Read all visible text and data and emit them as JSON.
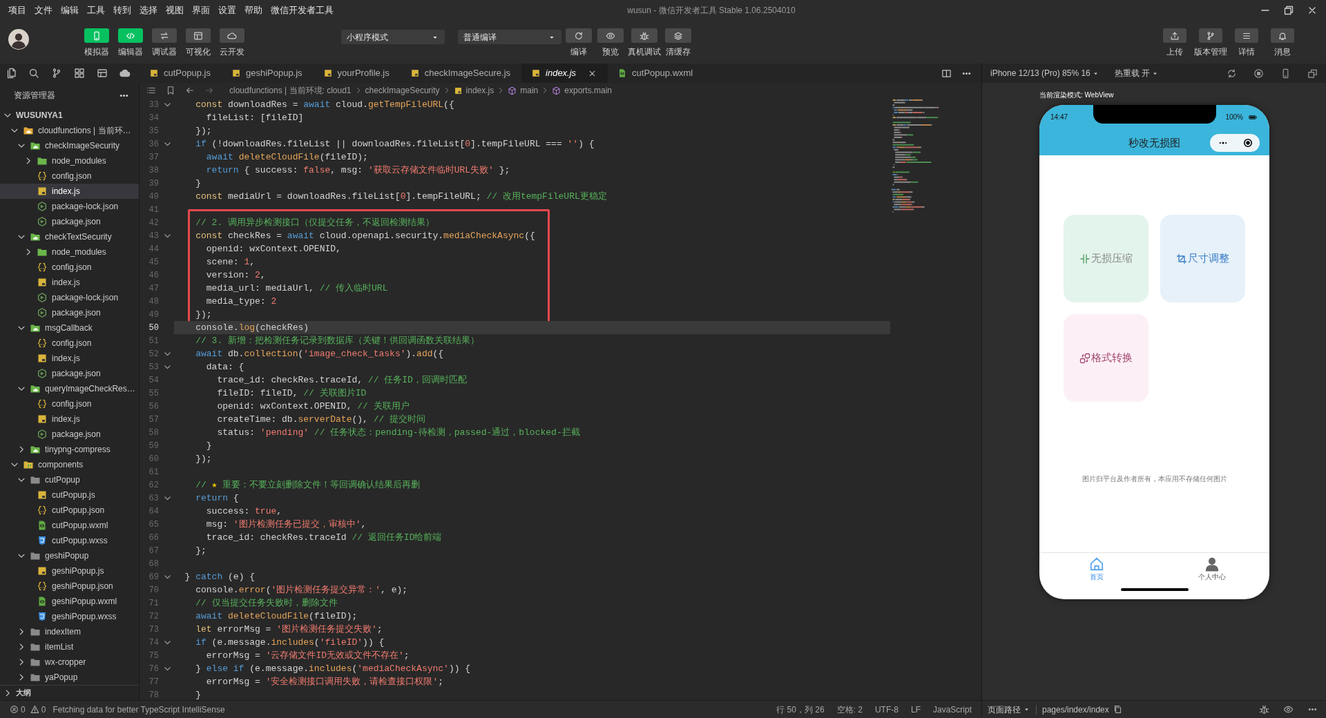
{
  "window": {
    "title": "wusun - 微信开发者工具 Stable 1.06.2504010"
  },
  "menu": [
    "项目",
    "文件",
    "编辑",
    "工具",
    "转到",
    "选择",
    "视图",
    "界面",
    "设置",
    "帮助",
    "微信开发者工具"
  ],
  "mode_buttons": [
    {
      "label": "模拟器",
      "selected": true
    },
    {
      "label": "编辑器",
      "selected": true
    },
    {
      "label": "调试器",
      "selected": false
    },
    {
      "label": "可视化",
      "selected": false
    },
    {
      "label": "云开发",
      "selected": false
    }
  ],
  "dropdowns": [
    {
      "value": "小程序模式"
    },
    {
      "value": "普通编译"
    }
  ],
  "compile_buttons": [
    {
      "label": "编译"
    },
    {
      "label": "预览"
    },
    {
      "label": "真机调试"
    },
    {
      "label": "清缓存"
    }
  ],
  "right_buttons": [
    {
      "label": "上传"
    },
    {
      "label": "版本管理"
    },
    {
      "label": "详情"
    },
    {
      "label": "消息"
    }
  ],
  "tabs": [
    {
      "label": "cutPopup.js",
      "kind": "js",
      "selected": false
    },
    {
      "label": "geshiPopup.js",
      "kind": "js",
      "selected": false
    },
    {
      "label": "yourProfile.js",
      "kind": "js",
      "selected": false
    },
    {
      "label": "checkImageSecure.js",
      "kind": "js",
      "selected": false
    },
    {
      "label": "index.js",
      "kind": "js",
      "selected": true
    },
    {
      "label": "cutPopup.wxml",
      "kind": "wxml",
      "selected": false
    }
  ],
  "breadcrumb": [
    {
      "label": "cloudfunctions | 当前环境: cloud1",
      "kind": "path"
    },
    {
      "label": "checkImageSecurity",
      "kind": "path"
    },
    {
      "label": "index.js",
      "kind": "file"
    },
    {
      "label": "main",
      "kind": "symbol"
    },
    {
      "label": "exports.main",
      "kind": "symbol"
    }
  ],
  "explorer": {
    "title": "资源管理器",
    "root": {
      "label": "WUSUNYA1",
      "kind": "workspace",
      "expanded": true,
      "selected": false,
      "children": [
        {
          "label": "cloudfunctions | 当前环…",
          "kind": "cloudroot",
          "expanded": true,
          "selected": false,
          "children": [
            {
              "label": "checkImageSecurity",
              "kind": "cloudfn",
              "expanded": true,
              "selected": false,
              "children": [
                {
                  "label": "node_modules",
                  "kind": "nodefolder",
                  "expanded": false,
                  "selected": false
                },
                {
                  "label": "config.json",
                  "kind": "json",
                  "selected": false
                },
                {
                  "label": "index.js",
                  "kind": "js",
                  "selected": true
                },
                {
                  "label": "package-lock.json",
                  "kind": "npm",
                  "selected": false
                },
                {
                  "label": "package.json",
                  "kind": "npm",
                  "selected": false
                }
              ]
            },
            {
              "label": "checkTextSecurity",
              "kind": "cloudfn",
              "expanded": true,
              "selected": false,
              "children": [
                {
                  "label": "node_modules",
                  "kind": "nodefolder",
                  "expanded": false,
                  "selected": false
                },
                {
                  "label": "config.json",
                  "kind": "json",
                  "selected": false
                },
                {
                  "label": "index.js",
                  "kind": "js",
                  "selected": false
                },
                {
                  "label": "package-lock.json",
                  "kind": "npm",
                  "selected": false
                },
                {
                  "label": "package.json",
                  "kind": "npm",
                  "selected": false
                }
              ]
            },
            {
              "label": "msgCallback",
              "kind": "cloudfn",
              "expanded": true,
              "selected": false,
              "children": [
                {
                  "label": "config.json",
                  "kind": "json",
                  "selected": false
                },
                {
                  "label": "index.js",
                  "kind": "js",
                  "selected": false
                },
                {
                  "label": "package.json",
                  "kind": "npm",
                  "selected": false
                }
              ]
            },
            {
              "label": "queryImageCheckRes…",
              "kind": "cloudfn",
              "expanded": true,
              "selected": false,
              "children": [
                {
                  "label": "config.json",
                  "kind": "json",
                  "selected": false
                },
                {
                  "label": "index.js",
                  "kind": "js",
                  "selected": false
                },
                {
                  "label": "package.json",
                  "kind": "npm",
                  "selected": false
                }
              ]
            },
            {
              "label": "tinypng-compress",
              "kind": "cloudfn",
              "expanded": false,
              "selected": false
            }
          ]
        },
        {
          "label": "components",
          "kind": "components",
          "expanded": true,
          "selected": false,
          "children": [
            {
              "label": "cutPopup",
              "kind": "folder",
              "expanded": true,
              "selected": false,
              "children": [
                {
                  "label": "cutPopup.js",
                  "kind": "js",
                  "selected": false
                },
                {
                  "label": "cutPopup.json",
                  "kind": "json",
                  "selected": false
                },
                {
                  "label": "cutPopup.wxml",
                  "kind": "wxml",
                  "selected": false
                },
                {
                  "label": "cutPopup.wxss",
                  "kind": "wxss",
                  "selected": false
                }
              ]
            },
            {
              "label": "geshiPopup",
              "kind": "folder",
              "expanded": true,
              "selected": false,
              "children": [
                {
                  "label": "geshiPopup.js",
                  "kind": "js",
                  "selected": false
                },
                {
                  "label": "geshiPopup.json",
                  "kind": "json",
                  "selected": false
                },
                {
                  "label": "geshiPopup.wxml",
                  "kind": "wxml",
                  "selected": false
                },
                {
                  "label": "geshiPopup.wxss",
                  "kind": "wxss",
                  "selected": false
                }
              ]
            },
            {
              "label": "indexItem",
              "kind": "folder",
              "expanded": false,
              "selected": false
            },
            {
              "label": "itemList",
              "kind": "folder",
              "expanded": false,
              "selected": false
            },
            {
              "label": "wx-cropper",
              "kind": "folder",
              "expanded": false,
              "selected": false
            },
            {
              "label": "yaPopup",
              "kind": "folder",
              "expanded": false,
              "selected": false
            }
          ]
        }
      ]
    },
    "outline": {
      "label": "大纲",
      "expanded": false
    }
  },
  "editor": {
    "segments": [
      {
        "boxed": false,
        "lines": [
          {
            "n": "33",
            "fold": true,
            "current": false,
            "tokens": [
              {
                "kind": "decl",
                "text": "    const"
              },
              {
                "kind": "plain",
                "text": " downloadRes = "
              },
              {
                "kind": "keyword",
                "text": "await"
              },
              {
                "kind": "plain",
                "text": " cloud."
              },
              {
                "kind": "function",
                "text": "getTempFileURL"
              },
              {
                "kind": "plain",
                "text": "({"
              }
            ]
          },
          {
            "n": "34",
            "fold": false,
            "current": false,
            "tokens": [
              {
                "kind": "plain",
                "text": "      fileList: [fileID]"
              }
            ]
          },
          {
            "n": "35",
            "fold": false,
            "current": false,
            "tokens": [
              {
                "kind": "plain",
                "text": "    });"
              }
            ]
          },
          {
            "n": "36",
            "fold": true,
            "current": false,
            "tokens": [
              {
                "kind": "keyword",
                "text": "    if"
              },
              {
                "kind": "plain",
                "text": " (!downloadRes.fileList || downloadRes.fileList["
              },
              {
                "kind": "number",
                "text": "0"
              },
              {
                "kind": "plain",
                "text": "].tempFileURL === "
              },
              {
                "kind": "string",
                "text": "''"
              },
              {
                "kind": "plain",
                "text": ") {"
              }
            ]
          },
          {
            "n": "37",
            "fold": false,
            "current": false,
            "tokens": [
              {
                "kind": "keyword",
                "text": "      await"
              },
              {
                "kind": "function",
                "text": " deleteCloudFile"
              },
              {
                "kind": "plain",
                "text": "(fileID);"
              }
            ]
          },
          {
            "n": "38",
            "fold": false,
            "current": false,
            "tokens": [
              {
                "kind": "keyword",
                "text": "      return"
              },
              {
                "kind": "plain",
                "text": " { success: "
              },
              {
                "kind": "number",
                "text": "false"
              },
              {
                "kind": "plain",
                "text": ", msg: "
              },
              {
                "kind": "string",
                "text": "'获取云存储文件临时URL失败'"
              },
              {
                "kind": "plain",
                "text": " };"
              }
            ]
          },
          {
            "n": "39",
            "fold": false,
            "current": false,
            "tokens": [
              {
                "kind": "plain",
                "text": "    }"
              }
            ]
          },
          {
            "n": "40",
            "fold": false,
            "current": false,
            "tokens": [
              {
                "kind": "decl",
                "text": "    const"
              },
              {
                "kind": "plain",
                "text": " mediaUrl = downloadRes.fileList["
              },
              {
                "kind": "number",
                "text": "0"
              },
              {
                "kind": "plain",
                "text": "].tempFileURL; "
              },
              {
                "kind": "comment",
                "text": "// 改用tempFileURL更稳定"
              }
            ]
          },
          {
            "n": "41",
            "fold": false,
            "current": false
          }
        ]
      },
      {
        "boxed": true,
        "lines": [
          {
            "n": "42",
            "fold": false,
            "current": false,
            "tokens": [
              {
                "kind": "comment",
                "text": "    // 2. 调用异步检测接口（仅提交任务，不返回检测结果）"
              }
            ]
          },
          {
            "n": "43",
            "fold": true,
            "current": false,
            "tokens": [
              {
                "kind": "decl",
                "text": "    const"
              },
              {
                "kind": "plain",
                "text": " checkRes = "
              },
              {
                "kind": "keyword",
                "text": "await"
              },
              {
                "kind": "plain",
                "text": " cloud.openapi.security."
              },
              {
                "kind": "function",
                "text": "mediaCheckAsync"
              },
              {
                "kind": "plain",
                "text": "({"
              }
            ]
          },
          {
            "n": "44",
            "fold": false,
            "current": false,
            "tokens": [
              {
                "kind": "plain",
                "text": "      openid: wxContext.OPENID,"
              }
            ]
          },
          {
            "n": "45",
            "fold": false,
            "current": false,
            "tokens": [
              {
                "kind": "plain",
                "text": "      scene: "
              },
              {
                "kind": "number",
                "text": "1"
              },
              {
                "kind": "plain",
                "text": ","
              }
            ]
          },
          {
            "n": "46",
            "fold": false,
            "current": false,
            "tokens": [
              {
                "kind": "plain",
                "text": "      version: "
              },
              {
                "kind": "number",
                "text": "2"
              },
              {
                "kind": "plain",
                "text": ","
              }
            ]
          },
          {
            "n": "47",
            "fold": false,
            "current": false,
            "tokens": [
              {
                "kind": "plain",
                "text": "      media_url: mediaUrl, "
              },
              {
                "kind": "comment",
                "text": "// 传入临时URL"
              }
            ]
          },
          {
            "n": "48",
            "fold": false,
            "current": false,
            "tokens": [
              {
                "kind": "plain",
                "text": "      media_type: "
              },
              {
                "kind": "number",
                "text": "2"
              }
            ]
          },
          {
            "n": "49",
            "fold": false,
            "current": false,
            "tokens": [
              {
                "kind": "plain",
                "text": "    });"
              }
            ]
          }
        ]
      },
      {
        "boxed": false,
        "lines": [
          {
            "n": "50",
            "fold": false,
            "current": true,
            "tokens": [
              {
                "kind": "plain",
                "text": "    console."
              },
              {
                "kind": "function",
                "text": "log"
              },
              {
                "kind": "plain",
                "text": "(checkRes)"
              }
            ]
          },
          {
            "n": "51",
            "fold": false,
            "current": false,
            "tokens": [
              {
                "kind": "comment",
                "text": "    // 3. 新增：把检测任务记录到数据库（关键！供回调函数关联结果）"
              }
            ]
          },
          {
            "n": "52",
            "fold": true,
            "current": false,
            "tokens": [
              {
                "kind": "keyword",
                "text": "    await"
              },
              {
                "kind": "plain",
                "text": " db."
              },
              {
                "kind": "function",
                "text": "collection"
              },
              {
                "kind": "plain",
                "text": "("
              },
              {
                "kind": "string",
                "text": "'image_check_tasks'"
              },
              {
                "kind": "plain",
                "text": ")."
              },
              {
                "kind": "function",
                "text": "add"
              },
              {
                "kind": "plain",
                "text": "({"
              }
            ]
          },
          {
            "n": "53",
            "fold": true,
            "current": false,
            "tokens": [
              {
                "kind": "plain",
                "text": "      data: {"
              }
            ]
          },
          {
            "n": "54",
            "fold": false,
            "current": false,
            "tokens": [
              {
                "kind": "plain",
                "text": "        trace_id: checkRes.traceId, "
              },
              {
                "kind": "comment",
                "text": "// 任务ID，回调时匹配"
              }
            ]
          },
          {
            "n": "55",
            "fold": false,
            "current": false,
            "tokens": [
              {
                "kind": "plain",
                "text": "        fileID: fileID, "
              },
              {
                "kind": "comment",
                "text": "// 关联图片ID"
              }
            ]
          },
          {
            "n": "56",
            "fold": false,
            "current": false,
            "tokens": [
              {
                "kind": "plain",
                "text": "        openid: wxContext.OPENID, "
              },
              {
                "kind": "comment",
                "text": "// 关联用户"
              }
            ]
          },
          {
            "n": "57",
            "fold": false,
            "current": false,
            "tokens": [
              {
                "kind": "plain",
                "text": "        createTime: db."
              },
              {
                "kind": "function",
                "text": "serverDate"
              },
              {
                "kind": "plain",
                "text": "(), "
              },
              {
                "kind": "comment",
                "text": "// 提交时间"
              }
            ]
          },
          {
            "n": "58",
            "fold": false,
            "current": false,
            "tokens": [
              {
                "kind": "plain",
                "text": "        status: "
              },
              {
                "kind": "string",
                "text": "'pending'"
              },
              {
                "kind": "comment",
                "text": " // 任务状态：pending-待检测，passed-通过，blocked-拦截"
              }
            ]
          },
          {
            "n": "59",
            "fold": false,
            "current": false,
            "tokens": [
              {
                "kind": "plain",
                "text": "      }"
              }
            ]
          },
          {
            "n": "60",
            "fold": false,
            "current": false,
            "tokens": [
              {
                "kind": "plain",
                "text": "    });"
              }
            ]
          },
          {
            "n": "61",
            "fold": false,
            "current": false
          },
          {
            "n": "62",
            "fold": false,
            "current": false,
            "tokens": [
              {
                "kind": "comment",
                "text": "    // "
              },
              {
                "kind": "emoji",
                "text": "★"
              },
              {
                "kind": "comment",
                "text": " 重要：不要立刻删除文件！等回调确认结果后再删"
              }
            ]
          },
          {
            "n": "63",
            "fold": true,
            "current": false,
            "tokens": [
              {
                "kind": "keyword",
                "text": "    return"
              },
              {
                "kind": "plain",
                "text": " {"
              }
            ]
          },
          {
            "n": "64",
            "fold": false,
            "current": false,
            "tokens": [
              {
                "kind": "plain",
                "text": "      success: "
              },
              {
                "kind": "number",
                "text": "true"
              },
              {
                "kind": "plain",
                "text": ","
              }
            ]
          },
          {
            "n": "65",
            "fold": false,
            "current": false,
            "tokens": [
              {
                "kind": "plain",
                "text": "      msg: "
              },
              {
                "kind": "string",
                "text": "'图片检测任务已提交，审核中'"
              },
              {
                "kind": "plain",
                "text": ","
              }
            ]
          },
          {
            "n": "66",
            "fold": false,
            "current": false,
            "tokens": [
              {
                "kind": "plain",
                "text": "      trace_id: checkRes.traceId "
              },
              {
                "kind": "comment",
                "text": "// 返回任务ID给前端"
              }
            ]
          },
          {
            "n": "67",
            "fold": false,
            "current": false,
            "tokens": [
              {
                "kind": "plain",
                "text": "    };"
              }
            ]
          },
          {
            "n": "68",
            "fold": false,
            "current": false
          },
          {
            "n": "69",
            "fold": true,
            "current": false,
            "tokens": [
              {
                "kind": "plain",
                "text": "  } "
              },
              {
                "kind": "keyword",
                "text": "catch"
              },
              {
                "kind": "plain",
                "text": " (e) {"
              }
            ]
          },
          {
            "n": "70",
            "fold": false,
            "current": false,
            "tokens": [
              {
                "kind": "plain",
                "text": "    console."
              },
              {
                "kind": "function",
                "text": "error"
              },
              {
                "kind": "plain",
                "text": "("
              },
              {
                "kind": "string",
                "text": "'图片检测任务提交异常：'"
              },
              {
                "kind": "plain",
                "text": ", e);"
              }
            ]
          },
          {
            "n": "71",
            "fold": false,
            "current": false,
            "tokens": [
              {
                "kind": "comment",
                "text": "    // 仅当提交任务失败时，删除文件"
              }
            ]
          },
          {
            "n": "72",
            "fold": false,
            "current": false,
            "tokens": [
              {
                "kind": "keyword",
                "text": "    await"
              },
              {
                "kind": "function",
                "text": " deleteCloudFile"
              },
              {
                "kind": "plain",
                "text": "(fileID);"
              }
            ]
          },
          {
            "n": "73",
            "fold": false,
            "current": false,
            "tokens": [
              {
                "kind": "decl",
                "text": "    let"
              },
              {
                "kind": "plain",
                "text": " errorMsg = "
              },
              {
                "kind": "string",
                "text": "'图片检测任务提交失败'"
              },
              {
                "kind": "plain",
                "text": ";"
              }
            ]
          },
          {
            "n": "74",
            "fold": true,
            "current": false,
            "tokens": [
              {
                "kind": "keyword",
                "text": "    if"
              },
              {
                "kind": "plain",
                "text": " (e.message."
              },
              {
                "kind": "function",
                "text": "includes"
              },
              {
                "kind": "plain",
                "text": "("
              },
              {
                "kind": "string",
                "text": "'fileID'"
              },
              {
                "kind": "plain",
                "text": ")) {"
              }
            ]
          },
          {
            "n": "75",
            "fold": false,
            "current": false,
            "tokens": [
              {
                "kind": "plain",
                "text": "      errorMsg = "
              },
              {
                "kind": "string",
                "text": "'云存储文件ID无效或文件不存在'"
              },
              {
                "kind": "plain",
                "text": ";"
              }
            ]
          },
          {
            "n": "76",
            "fold": true,
            "current": false,
            "tokens": [
              {
                "kind": "plain",
                "text": "    } "
              },
              {
                "kind": "keyword",
                "text": "else if"
              },
              {
                "kind": "plain",
                "text": " (e.message."
              },
              {
                "kind": "function",
                "text": "includes"
              },
              {
                "kind": "plain",
                "text": "("
              },
              {
                "kind": "string",
                "text": "'mediaCheckAsync'"
              },
              {
                "kind": "plain",
                "text": ")) {"
              }
            ]
          },
          {
            "n": "77",
            "fold": false,
            "current": false,
            "tokens": [
              {
                "kind": "plain",
                "text": "      errorMsg = "
              },
              {
                "kind": "string",
                "text": "'安全检测接口调用失败，请检查接口权限'"
              },
              {
                "kind": "plain",
                "text": ";"
              }
            ]
          },
          {
            "n": "78",
            "fold": false,
            "current": false,
            "tokens": [
              {
                "kind": "plain",
                "text": "    }"
              }
            ]
          }
        ]
      }
    ]
  },
  "simulator": {
    "device": "iPhone 12/13 (Pro) 85% 16",
    "hot_reload": "热重载 开",
    "render_mode": "当前渲染模式: WebView",
    "time": "14:47",
    "battery": "100%",
    "nav_title": "秒改无损图",
    "cards": [
      {
        "label": "无损压缩",
        "color": "#e3f4ec"
      },
      {
        "label": "尺寸调整",
        "color": "#e6f1f9"
      },
      {
        "label": "格式转换",
        "color": "#fcf0f6"
      }
    ],
    "note": "图片归平台及作者所有，本应用不存储任何图片",
    "tabbar": [
      {
        "label": "首页",
        "selected": true
      },
      {
        "label": "个人中心",
        "selected": false
      }
    ]
  },
  "status_bar": {
    "errors": "0",
    "warnings": "0",
    "message": "Fetching data for better TypeScript IntelliSense",
    "items": [
      "行 50，列 26",
      "空格: 2",
      "UTF-8",
      "LF",
      "JavaScript"
    ],
    "page_path_label": "页面路径",
    "page_path": "pages/index/index"
  }
}
